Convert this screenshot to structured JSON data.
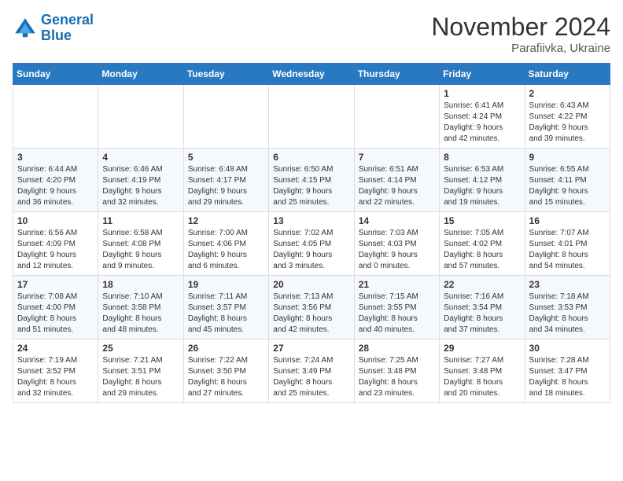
{
  "header": {
    "logo_line1": "General",
    "logo_line2": "Blue",
    "month": "November 2024",
    "location": "Parafiivka, Ukraine"
  },
  "days_of_week": [
    "Sunday",
    "Monday",
    "Tuesday",
    "Wednesday",
    "Thursday",
    "Friday",
    "Saturday"
  ],
  "weeks": [
    [
      {
        "day": "",
        "info": ""
      },
      {
        "day": "",
        "info": ""
      },
      {
        "day": "",
        "info": ""
      },
      {
        "day": "",
        "info": ""
      },
      {
        "day": "",
        "info": ""
      },
      {
        "day": "1",
        "info": "Sunrise: 6:41 AM\nSunset: 4:24 PM\nDaylight: 9 hours\nand 42 minutes."
      },
      {
        "day": "2",
        "info": "Sunrise: 6:43 AM\nSunset: 4:22 PM\nDaylight: 9 hours\nand 39 minutes."
      }
    ],
    [
      {
        "day": "3",
        "info": "Sunrise: 6:44 AM\nSunset: 4:20 PM\nDaylight: 9 hours\nand 36 minutes."
      },
      {
        "day": "4",
        "info": "Sunrise: 6:46 AM\nSunset: 4:19 PM\nDaylight: 9 hours\nand 32 minutes."
      },
      {
        "day": "5",
        "info": "Sunrise: 6:48 AM\nSunset: 4:17 PM\nDaylight: 9 hours\nand 29 minutes."
      },
      {
        "day": "6",
        "info": "Sunrise: 6:50 AM\nSunset: 4:15 PM\nDaylight: 9 hours\nand 25 minutes."
      },
      {
        "day": "7",
        "info": "Sunrise: 6:51 AM\nSunset: 4:14 PM\nDaylight: 9 hours\nand 22 minutes."
      },
      {
        "day": "8",
        "info": "Sunrise: 6:53 AM\nSunset: 4:12 PM\nDaylight: 9 hours\nand 19 minutes."
      },
      {
        "day": "9",
        "info": "Sunrise: 6:55 AM\nSunset: 4:11 PM\nDaylight: 9 hours\nand 15 minutes."
      }
    ],
    [
      {
        "day": "10",
        "info": "Sunrise: 6:56 AM\nSunset: 4:09 PM\nDaylight: 9 hours\nand 12 minutes."
      },
      {
        "day": "11",
        "info": "Sunrise: 6:58 AM\nSunset: 4:08 PM\nDaylight: 9 hours\nand 9 minutes."
      },
      {
        "day": "12",
        "info": "Sunrise: 7:00 AM\nSunset: 4:06 PM\nDaylight: 9 hours\nand 6 minutes."
      },
      {
        "day": "13",
        "info": "Sunrise: 7:02 AM\nSunset: 4:05 PM\nDaylight: 9 hours\nand 3 minutes."
      },
      {
        "day": "14",
        "info": "Sunrise: 7:03 AM\nSunset: 4:03 PM\nDaylight: 9 hours\nand 0 minutes."
      },
      {
        "day": "15",
        "info": "Sunrise: 7:05 AM\nSunset: 4:02 PM\nDaylight: 8 hours\nand 57 minutes."
      },
      {
        "day": "16",
        "info": "Sunrise: 7:07 AM\nSunset: 4:01 PM\nDaylight: 8 hours\nand 54 minutes."
      }
    ],
    [
      {
        "day": "17",
        "info": "Sunrise: 7:08 AM\nSunset: 4:00 PM\nDaylight: 8 hours\nand 51 minutes."
      },
      {
        "day": "18",
        "info": "Sunrise: 7:10 AM\nSunset: 3:58 PM\nDaylight: 8 hours\nand 48 minutes."
      },
      {
        "day": "19",
        "info": "Sunrise: 7:11 AM\nSunset: 3:57 PM\nDaylight: 8 hours\nand 45 minutes."
      },
      {
        "day": "20",
        "info": "Sunrise: 7:13 AM\nSunset: 3:56 PM\nDaylight: 8 hours\nand 42 minutes."
      },
      {
        "day": "21",
        "info": "Sunrise: 7:15 AM\nSunset: 3:55 PM\nDaylight: 8 hours\nand 40 minutes."
      },
      {
        "day": "22",
        "info": "Sunrise: 7:16 AM\nSunset: 3:54 PM\nDaylight: 8 hours\nand 37 minutes."
      },
      {
        "day": "23",
        "info": "Sunrise: 7:18 AM\nSunset: 3:53 PM\nDaylight: 8 hours\nand 34 minutes."
      }
    ],
    [
      {
        "day": "24",
        "info": "Sunrise: 7:19 AM\nSunset: 3:52 PM\nDaylight: 8 hours\nand 32 minutes."
      },
      {
        "day": "25",
        "info": "Sunrise: 7:21 AM\nSunset: 3:51 PM\nDaylight: 8 hours\nand 29 minutes."
      },
      {
        "day": "26",
        "info": "Sunrise: 7:22 AM\nSunset: 3:50 PM\nDaylight: 8 hours\nand 27 minutes."
      },
      {
        "day": "27",
        "info": "Sunrise: 7:24 AM\nSunset: 3:49 PM\nDaylight: 8 hours\nand 25 minutes."
      },
      {
        "day": "28",
        "info": "Sunrise: 7:25 AM\nSunset: 3:48 PM\nDaylight: 8 hours\nand 23 minutes."
      },
      {
        "day": "29",
        "info": "Sunrise: 7:27 AM\nSunset: 3:48 PM\nDaylight: 8 hours\nand 20 minutes."
      },
      {
        "day": "30",
        "info": "Sunrise: 7:28 AM\nSunset: 3:47 PM\nDaylight: 8 hours\nand 18 minutes."
      }
    ]
  ]
}
